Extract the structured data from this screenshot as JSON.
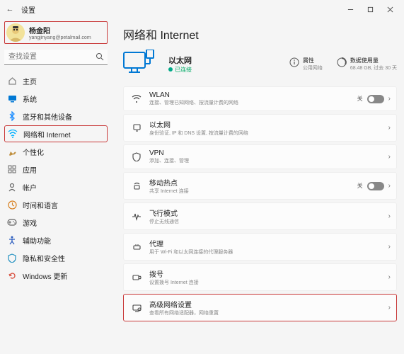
{
  "window": {
    "title": "设置"
  },
  "user": {
    "name": "杨金阳",
    "email": "yangjinyang@petalmail.com"
  },
  "search": {
    "placeholder": "查找设置"
  },
  "nav": [
    {
      "label": "主页",
      "icon": "home",
      "color": "#888"
    },
    {
      "label": "系统",
      "icon": "system",
      "color": "#0078d4"
    },
    {
      "label": "蓝牙和其他设备",
      "icon": "bluetooth",
      "color": "#1a8cff"
    },
    {
      "label": "网络和 Internet",
      "icon": "network",
      "color": "#00b0ff",
      "active": true
    },
    {
      "label": "个性化",
      "icon": "personalize",
      "color": "#c09040"
    },
    {
      "label": "应用",
      "icon": "apps",
      "color": "#666"
    },
    {
      "label": "帐户",
      "icon": "accounts",
      "color": "#666"
    },
    {
      "label": "时间和语言",
      "icon": "time",
      "color": "#d88020"
    },
    {
      "label": "游戏",
      "icon": "gaming",
      "color": "#666"
    },
    {
      "label": "辅助功能",
      "icon": "accessibility",
      "color": "#3060c0"
    },
    {
      "label": "隐私和安全性",
      "icon": "privacy",
      "color": "#2090c0"
    },
    {
      "label": "Windows 更新",
      "icon": "update",
      "color": "#d85040"
    }
  ],
  "page": {
    "heading": "网络和 Internet"
  },
  "status": {
    "title": "以太网",
    "sub": "已连接"
  },
  "prop1": {
    "title": "属性",
    "sub": "公用网络"
  },
  "prop2": {
    "title": "数据使用量",
    "sub": "68.48 GB, 过去 30 天"
  },
  "cards": [
    {
      "title": "WLAN",
      "sub": "连接、管理已知网络、按流量计费的网络",
      "toggle": true,
      "tlabel": "关"
    },
    {
      "title": "以太网",
      "sub": "身份验证, IP 和 DNS 设置, 按流量计费的网络"
    },
    {
      "title": "VPN",
      "sub": "添加、连接、管理"
    },
    {
      "title": "移动热点",
      "sub": "共享 Internet 连接",
      "toggle": true,
      "tlabel": "关"
    },
    {
      "title": "飞行模式",
      "sub": "停止无线通信"
    },
    {
      "title": "代理",
      "sub": "用于 Wi-Fi 和以太网连接的代理服务器"
    },
    {
      "title": "拨号",
      "sub": "设置拨号 Internet 连接"
    },
    {
      "title": "高级网络设置",
      "sub": "查看所有网络适配器，网络重置",
      "hl": true
    }
  ]
}
